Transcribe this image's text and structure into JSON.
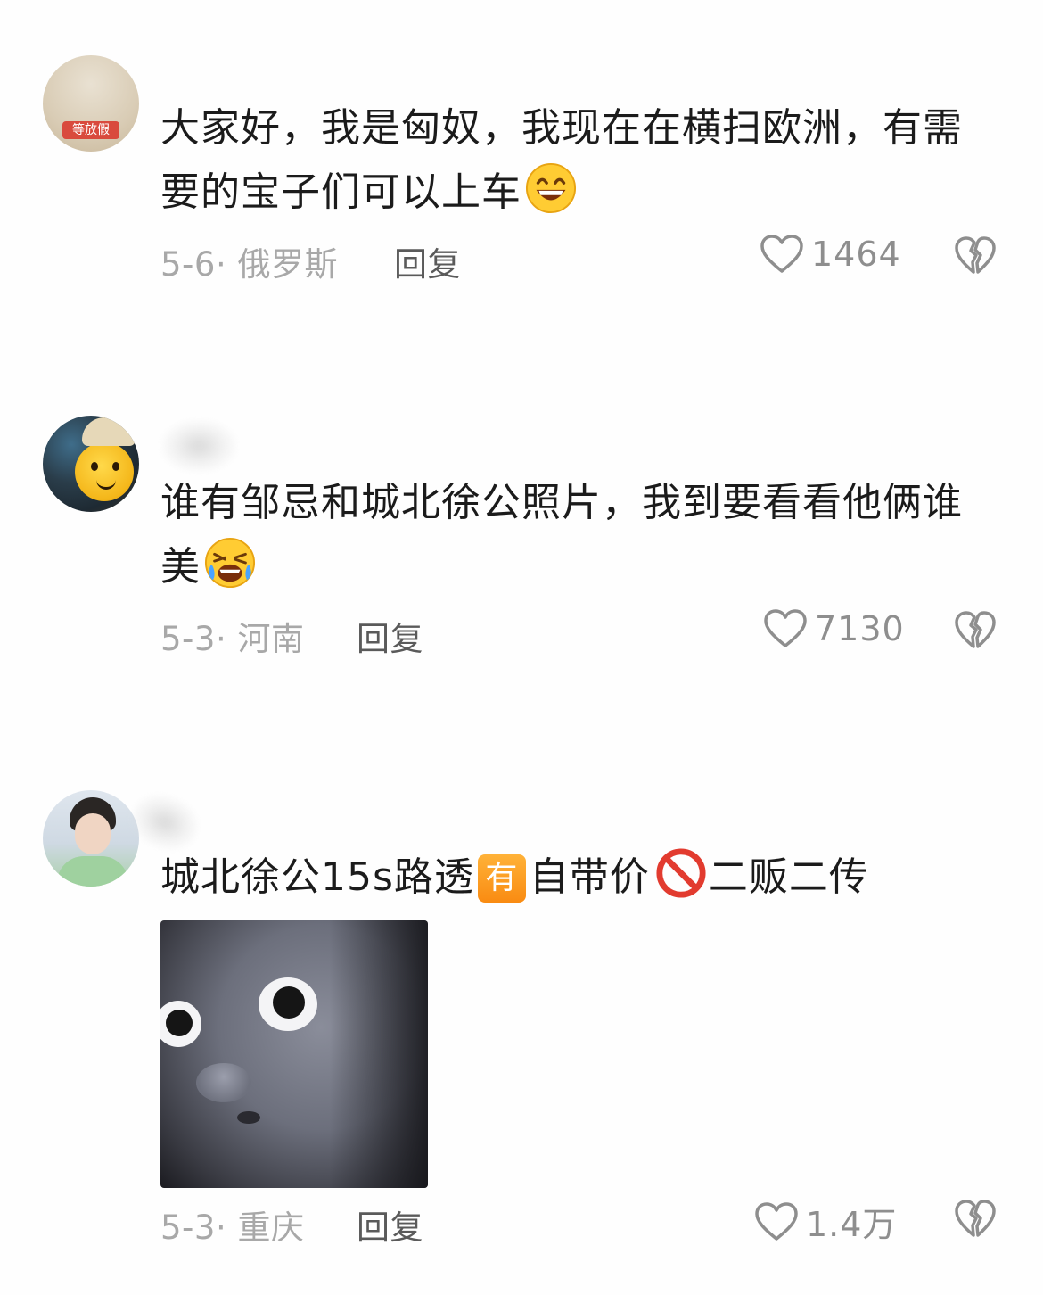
{
  "comments": [
    {
      "avatar_badge": "等放假",
      "text": "大家好，我是匈奴，我现在在横扫欧洲，有需要的宝子们可以上车",
      "emoji": "grinning-face",
      "date": "5-6",
      "location": "俄罗斯",
      "reply_label": "回复",
      "likes": "1464"
    },
    {
      "text": "谁有邹忌和城北徐公照片，我到要看看他俩谁美",
      "emoji": "rolling-on-floor-laughing",
      "date": "5-3",
      "location": "河南",
      "reply_label": "回复",
      "likes": "7130"
    },
    {
      "text_part1": "城北徐公15s路透",
      "tag": "有",
      "text_part2": "自带价",
      "emoji": "prohibited",
      "text_part3": "二贩二传",
      "media": "alien-face-meme-image",
      "date": "5-3",
      "location": "重庆",
      "reply_label": "回复",
      "likes": "1.4万"
    }
  ],
  "separator": "· ",
  "colors": {
    "text": "#1b1b1b",
    "meta": "#a8a8a8",
    "reply": "#5a5a5a",
    "like": "#8e8e8e",
    "tag": "#f98b12"
  }
}
